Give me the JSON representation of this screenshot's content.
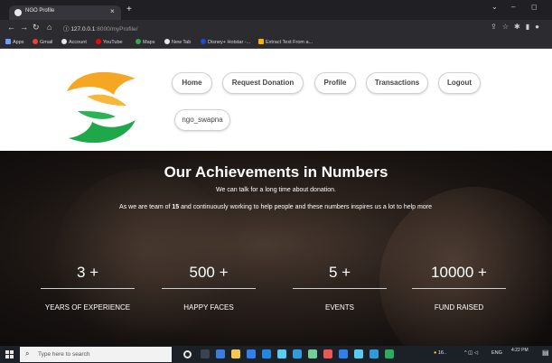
{
  "browser": {
    "tab_title": "NGO Profile",
    "tab_close": "×",
    "new_tab": "+",
    "url_host": "127.0.0.1",
    "url_rest": ":8000/myProfile/",
    "bookmarks": [
      {
        "label": "Apps",
        "color": "#6aa0f8"
      },
      {
        "label": "Gmail",
        "color": "#ea4335"
      },
      {
        "label": "Account",
        "color": "#e8e8e8"
      },
      {
        "label": "YouTube",
        "color": "#ff0000"
      },
      {
        "label": "Maps",
        "color": "#34a853"
      },
      {
        "label": "New Tab",
        "color": "#e8e8e8"
      },
      {
        "label": "Disney+ Hotstar -...",
        "color": "#1f4bd6"
      },
      {
        "label": "Extract Text From a...",
        "color": "#f4b400"
      }
    ]
  },
  "nav": {
    "home": "Home",
    "request_donation": "Request Donation",
    "profile": "Profile",
    "transactions": "Transactions",
    "logout": "Logout",
    "username": "ngo_swapna"
  },
  "hero": {
    "title": "Our Achievements in Numbers",
    "subtitle": "We can talk for a long time about donation.",
    "desc_before": "As we are team of ",
    "desc_bold": "15",
    "desc_after": " and continuously working to help people and these numbers inspires us a lot to help more"
  },
  "stats": [
    {
      "value": "3 +",
      "label": "YEARS OF EXPERIENCE"
    },
    {
      "value": "500 +",
      "label": "HAPPY FACES"
    },
    {
      "value": "5 +",
      "label": "EVENTS"
    },
    {
      "value": "10000 +",
      "label": "FUND RAISED"
    }
  ],
  "taskbar": {
    "search_placeholder": "Type here to search",
    "weather": "16..",
    "lang": "ENG",
    "time": "4:22 PM"
  },
  "colors": {
    "logo_orange": "#f5a623",
    "logo_green": "#1fa84a",
    "hero_bg": "#1e1814"
  }
}
